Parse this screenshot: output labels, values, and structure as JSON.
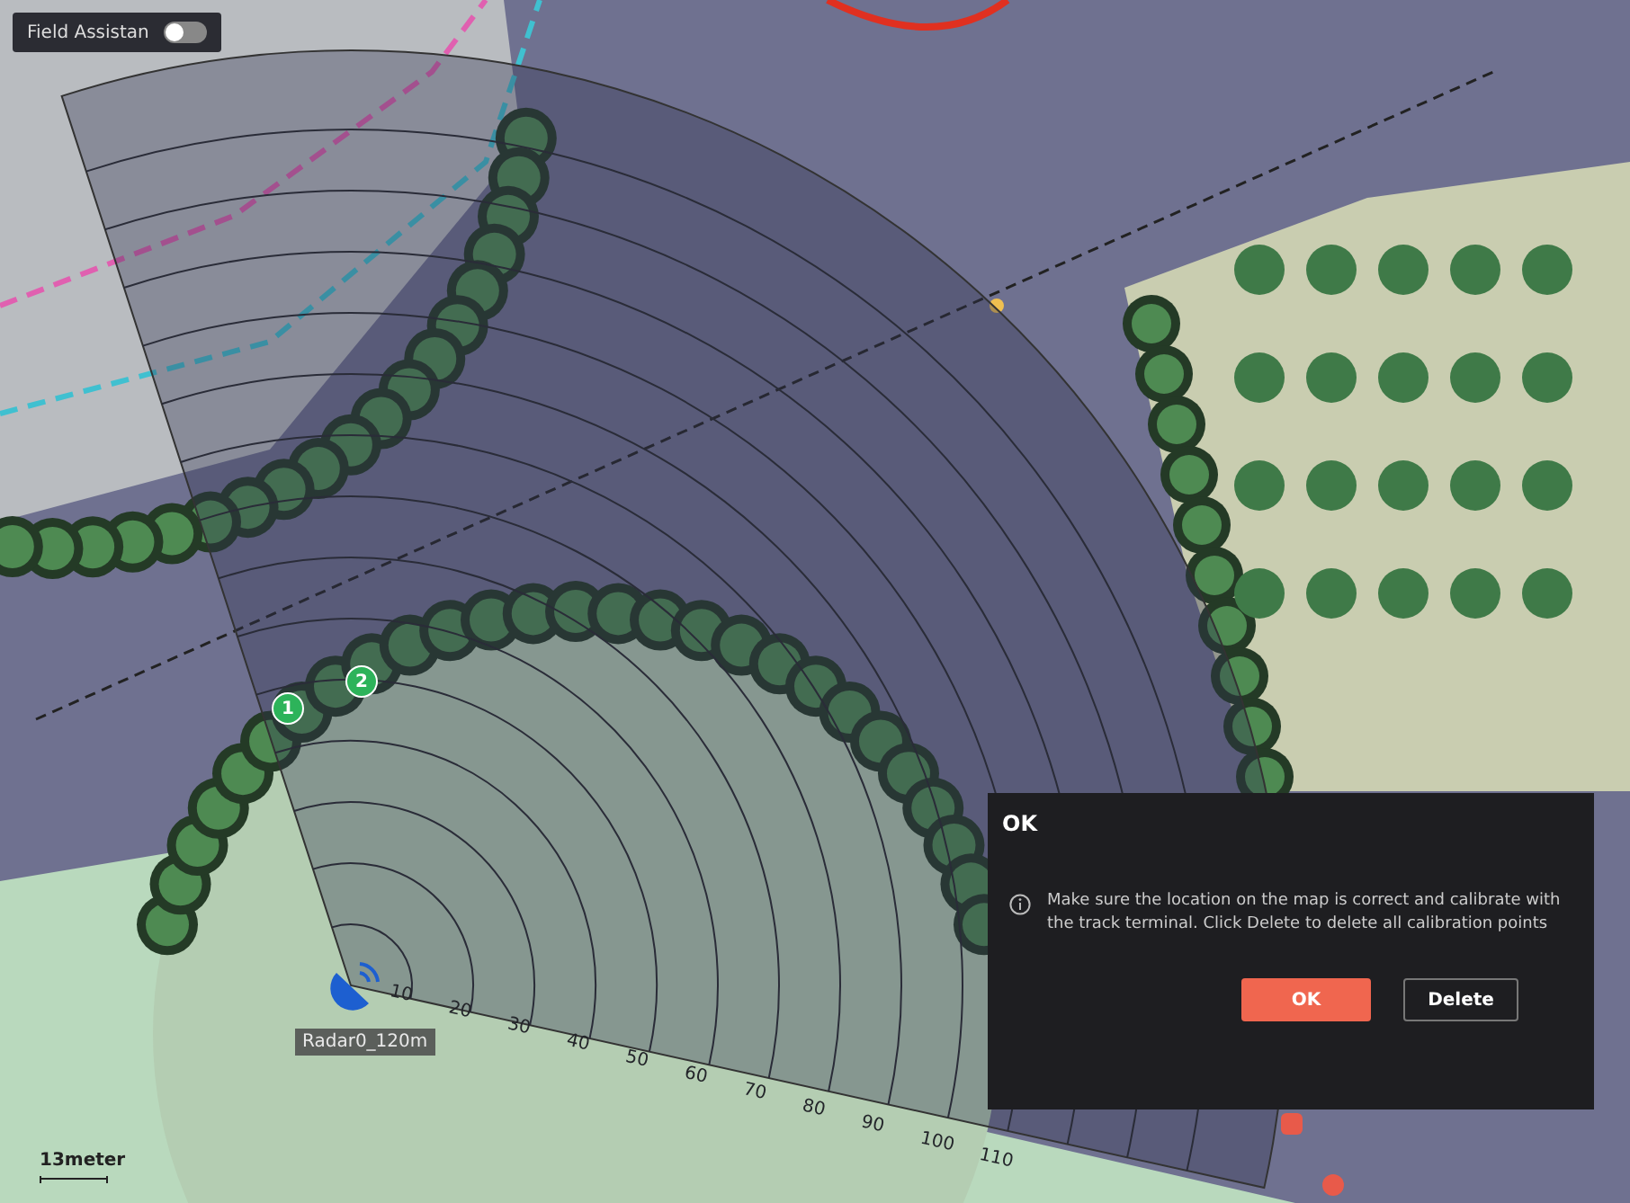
{
  "field_assistant": {
    "label": "Field Assistan",
    "on": false
  },
  "radar": {
    "name": "Radar0_120m",
    "ring_labels": [
      "10",
      "20",
      "30",
      "40",
      "50",
      "60",
      "70",
      "80",
      "90",
      "100",
      "110"
    ]
  },
  "calibration_points": [
    {
      "label": "1"
    },
    {
      "label": "2"
    }
  ],
  "scale": {
    "label": "13meter"
  },
  "dialog": {
    "title": "OK",
    "message": "Make sure the location on the map is correct and calibrate with the track terminal. Click Delete to delete all calibration points",
    "buttons": [
      {
        "label": "OK",
        "kind": "primary"
      },
      {
        "label": "Delete",
        "kind": "secondary"
      }
    ]
  }
}
